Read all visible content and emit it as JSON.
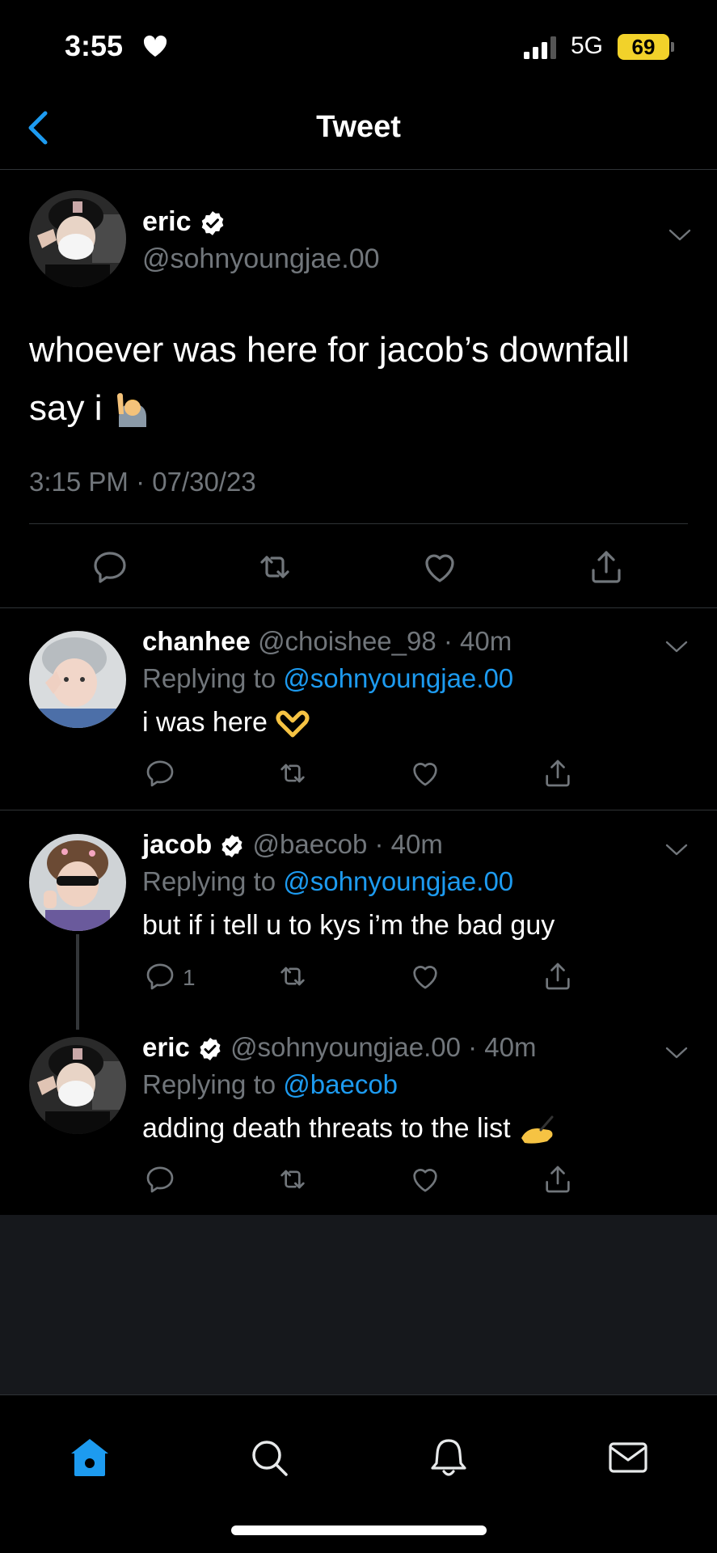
{
  "status_bar": {
    "time": "3:55",
    "network": "5G",
    "battery": "69"
  },
  "header": {
    "title": "Tweet"
  },
  "main_tweet": {
    "name": "eric",
    "handle": "@sohnyoungjae.00",
    "text_line1": "whoever was here for jacob’s downfall",
    "text_line2": "say i",
    "timestamp": "3:15 PM · 07/30/23"
  },
  "replies": [
    {
      "name": "chanhee",
      "meta": "@choishee_98 · 40m",
      "replying_prefix": "Replying to ",
      "replying_to": "@sohnyoungjae.00",
      "text": "i was here"
    },
    {
      "name": "jacob",
      "meta": "@baecob · 40m",
      "replying_prefix": "Replying to ",
      "replying_to": "@sohnyoungjae.00",
      "text": "but if i tell u to kys i’m the bad guy",
      "reply_count": "1"
    },
    {
      "name": "eric",
      "meta": "@sohnyoungjae.00 · 40m",
      "replying_prefix": "Replying to ",
      "replying_to": "@baecob",
      "text": "adding death threats to the list"
    }
  ],
  "colors": {
    "accent": "#1d9bf0",
    "background": "#000000",
    "muted": "#71767b",
    "battery": "#f2d22a"
  },
  "icons": [
    "heart-icon",
    "signal-icon",
    "back-chevron-icon",
    "verified-badge-icon",
    "chevron-down-icon",
    "reply-icon",
    "retweet-icon",
    "like-icon",
    "share-icon",
    "home-icon",
    "search-icon",
    "notifications-icon",
    "messages-icon"
  ]
}
